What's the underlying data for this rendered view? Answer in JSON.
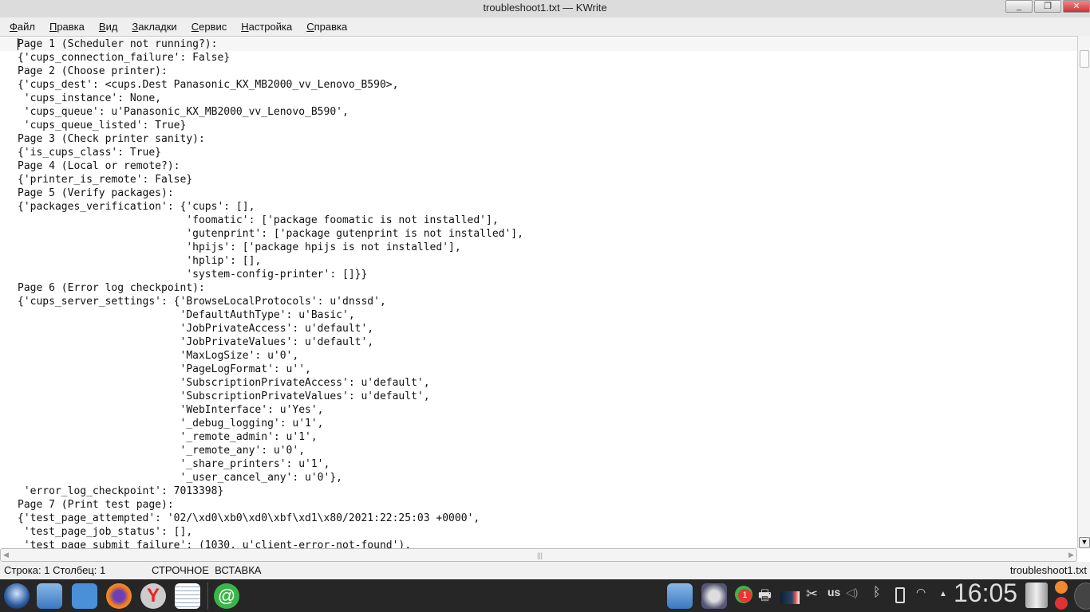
{
  "window": {
    "title": "troubleshoot1.txt — KWrite",
    "minimize": "_",
    "maximize": "❐",
    "close": "✕"
  },
  "menu": [
    {
      "label": "Файл",
      "accel": "Ф",
      "rest": "айл"
    },
    {
      "label": "Правка",
      "accel": "П",
      "rest": "равка"
    },
    {
      "label": "Вид",
      "accel": "В",
      "rest": "ид"
    },
    {
      "label": "Закладки",
      "accel": "З",
      "rest": "акладки"
    },
    {
      "label": "Сервис",
      "accel": "С",
      "rest": "ервис"
    },
    {
      "label": "Настройка",
      "accel": "Н",
      "rest": "астройка"
    },
    {
      "label": "Справка",
      "accel": "С",
      "rest": "правка"
    }
  ],
  "document": {
    "text": "Page 1 (Scheduler not running?):\n{'cups_connection_failure': False}\nPage 2 (Choose printer):\n{'cups_dest': <cups.Dest Panasonic_KX_MB2000_vv_Lenovo_B590>,\n 'cups_instance': None,\n 'cups_queue': u'Panasonic_KX_MB2000_vv_Lenovo_B590',\n 'cups_queue_listed': True}\nPage 3 (Check printer sanity):\n{'is_cups_class': True}\nPage 4 (Local or remote?):\n{'printer_is_remote': False}\nPage 5 (Verify packages):\n{'packages_verification': {'cups': [],\n                           'foomatic': ['package foomatic is not installed'],\n                           'gutenprint': ['package gutenprint is not installed'],\n                           'hpijs': ['package hpijs is not installed'],\n                           'hplip': [],\n                           'system-config-printer': []}}\nPage 6 (Error log checkpoint):\n{'cups_server_settings': {'BrowseLocalProtocols': u'dnssd',\n                          'DefaultAuthType': u'Basic',\n                          'JobPrivateAccess': u'default',\n                          'JobPrivateValues': u'default',\n                          'MaxLogSize': u'0',\n                          'PageLogFormat': u'',\n                          'SubscriptionPrivateAccess': u'default',\n                          'SubscriptionPrivateValues': u'default',\n                          'WebInterface': u'Yes',\n                          '_debug_logging': u'1',\n                          '_remote_admin': u'1',\n                          '_remote_any': u'0',\n                          '_share_printers': u'1',\n                          '_user_cancel_any': u'0'},\n 'error_log_checkpoint': 7013398}\nPage 7 (Print test page):\n{'test_page_attempted': '02/\\xd0\\xb0\\xd0\\xbf\\xd1\\x80/2021:22:25:03 +0000',\n 'test_page_job_status': [],\n 'test_page_submit_failure': (1030, u'client-error-not-found'),"
  },
  "status": {
    "position": "Строка: 1 Столбец: 1",
    "mode": "СТРОЧНОЕ  ВСТАВКА",
    "filename": "troubleshoot1.txt"
  },
  "taskbar": {
    "keyboard_layout": "us",
    "clock": "16:05",
    "notification_count": "1"
  }
}
